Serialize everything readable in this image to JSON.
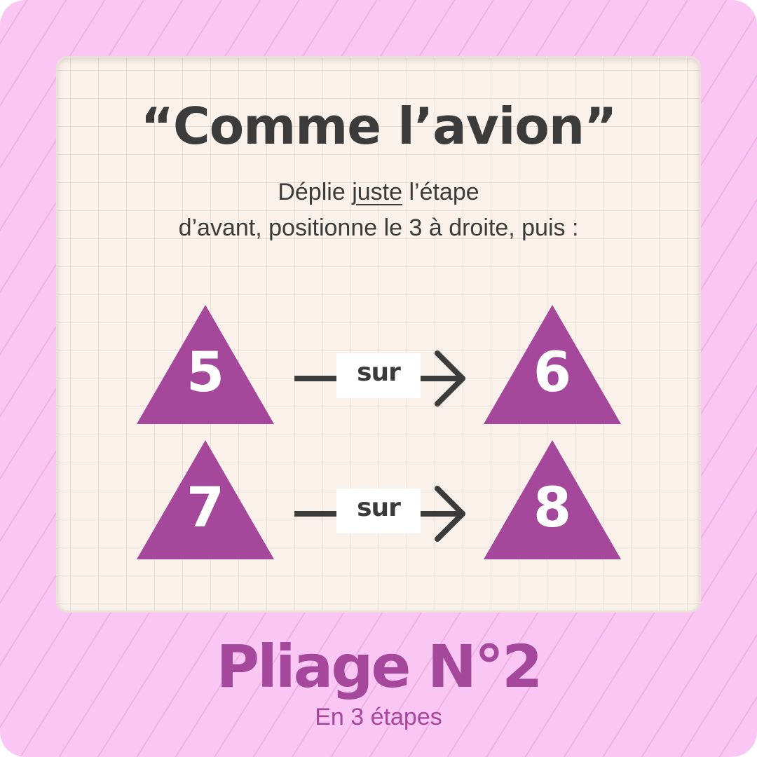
{
  "card": {
    "title": "“Comme l’avion”",
    "instruction_line1_before": "Déplie ",
    "instruction_line1_emphasis": "juste",
    "instruction_line1_after": " l’étape",
    "instruction_line2": "d’avant, positionne le 3 à droite, puis :"
  },
  "steps": [
    {
      "from": "5",
      "connector": "sur",
      "to": "6"
    },
    {
      "from": "7",
      "connector": "sur",
      "to": "8"
    }
  ],
  "footer": {
    "title": "Pliage N°2",
    "subtitle": "En 3 étapes"
  },
  "colors": {
    "background": "#fac6f4",
    "card": "#f9f1ea",
    "accent": "#a5479b",
    "text": "#3b3b3b"
  },
  "icons": {
    "shape": "triangle",
    "arrow": "arrow-right-icon"
  }
}
